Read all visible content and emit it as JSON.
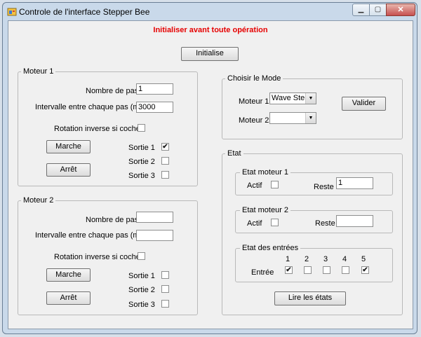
{
  "window": {
    "title": "Controle de l'interface Stepper Bee",
    "icon": "app-window-icon",
    "controls": {
      "minimize": "▁",
      "maximize": "▢",
      "close": "✕"
    }
  },
  "warning": {
    "text": "Initialiser avant toute opération",
    "color": "#e60000"
  },
  "initialise_label": "Initialise",
  "moteur1": {
    "title": "Moteur 1",
    "nb_pas_label": "Nombre de pas",
    "nb_pas_value": "1",
    "intervalle_label": "Intervalle entre chaque pas (ms)",
    "intervalle_value": "3000",
    "rotation_label": "Rotation inverse si coché",
    "rotation_checked": false,
    "marche_label": "Marche",
    "arret_label": "Arrêt",
    "sorties": [
      {
        "label": "Sortie 1",
        "checked": true
      },
      {
        "label": "Sortie 2",
        "checked": false
      },
      {
        "label": "Sortie 3",
        "checked": false
      }
    ]
  },
  "moteur2": {
    "title": "Moteur 2",
    "nb_pas_label": "Nombre de pas",
    "nb_pas_value": "",
    "intervalle_label": "Intervalle entre chaque pas (ms)",
    "intervalle_value": "",
    "rotation_label": "Rotation inverse si coché",
    "rotation_checked": false,
    "marche_label": "Marche",
    "arret_label": "Arrêt",
    "sorties": [
      {
        "label": "Sortie 1",
        "checked": false
      },
      {
        "label": "Sortie 2",
        "checked": false
      },
      {
        "label": "Sortie 3",
        "checked": false
      }
    ]
  },
  "mode": {
    "title": "Choisir le  Mode",
    "moteur1_label": "Moteur 1",
    "moteur1_value": "Wave Step",
    "moteur2_label": "Moteur 2",
    "moteur2_value": "",
    "valider_label": "Valider"
  },
  "etat": {
    "title": "Etat",
    "moteur1": {
      "title": "Etat moteur 1",
      "actif_label": "Actif",
      "actif_checked": false,
      "reste_label": "Reste",
      "reste_value": "1"
    },
    "moteur2": {
      "title": "Etat moteur 2",
      "actif_label": "Actif",
      "actif_checked": false,
      "reste_label": "Reste",
      "reste_value": ""
    },
    "entrees": {
      "title": "Etat des entrées",
      "row_label": "Entrée",
      "items": [
        {
          "label": "1",
          "checked": true
        },
        {
          "label": "2",
          "checked": false
        },
        {
          "label": "3",
          "checked": false
        },
        {
          "label": "4",
          "checked": false
        },
        {
          "label": "5",
          "checked": true
        }
      ]
    },
    "lire_label": "Lire les états"
  },
  "check_mark": "✔"
}
